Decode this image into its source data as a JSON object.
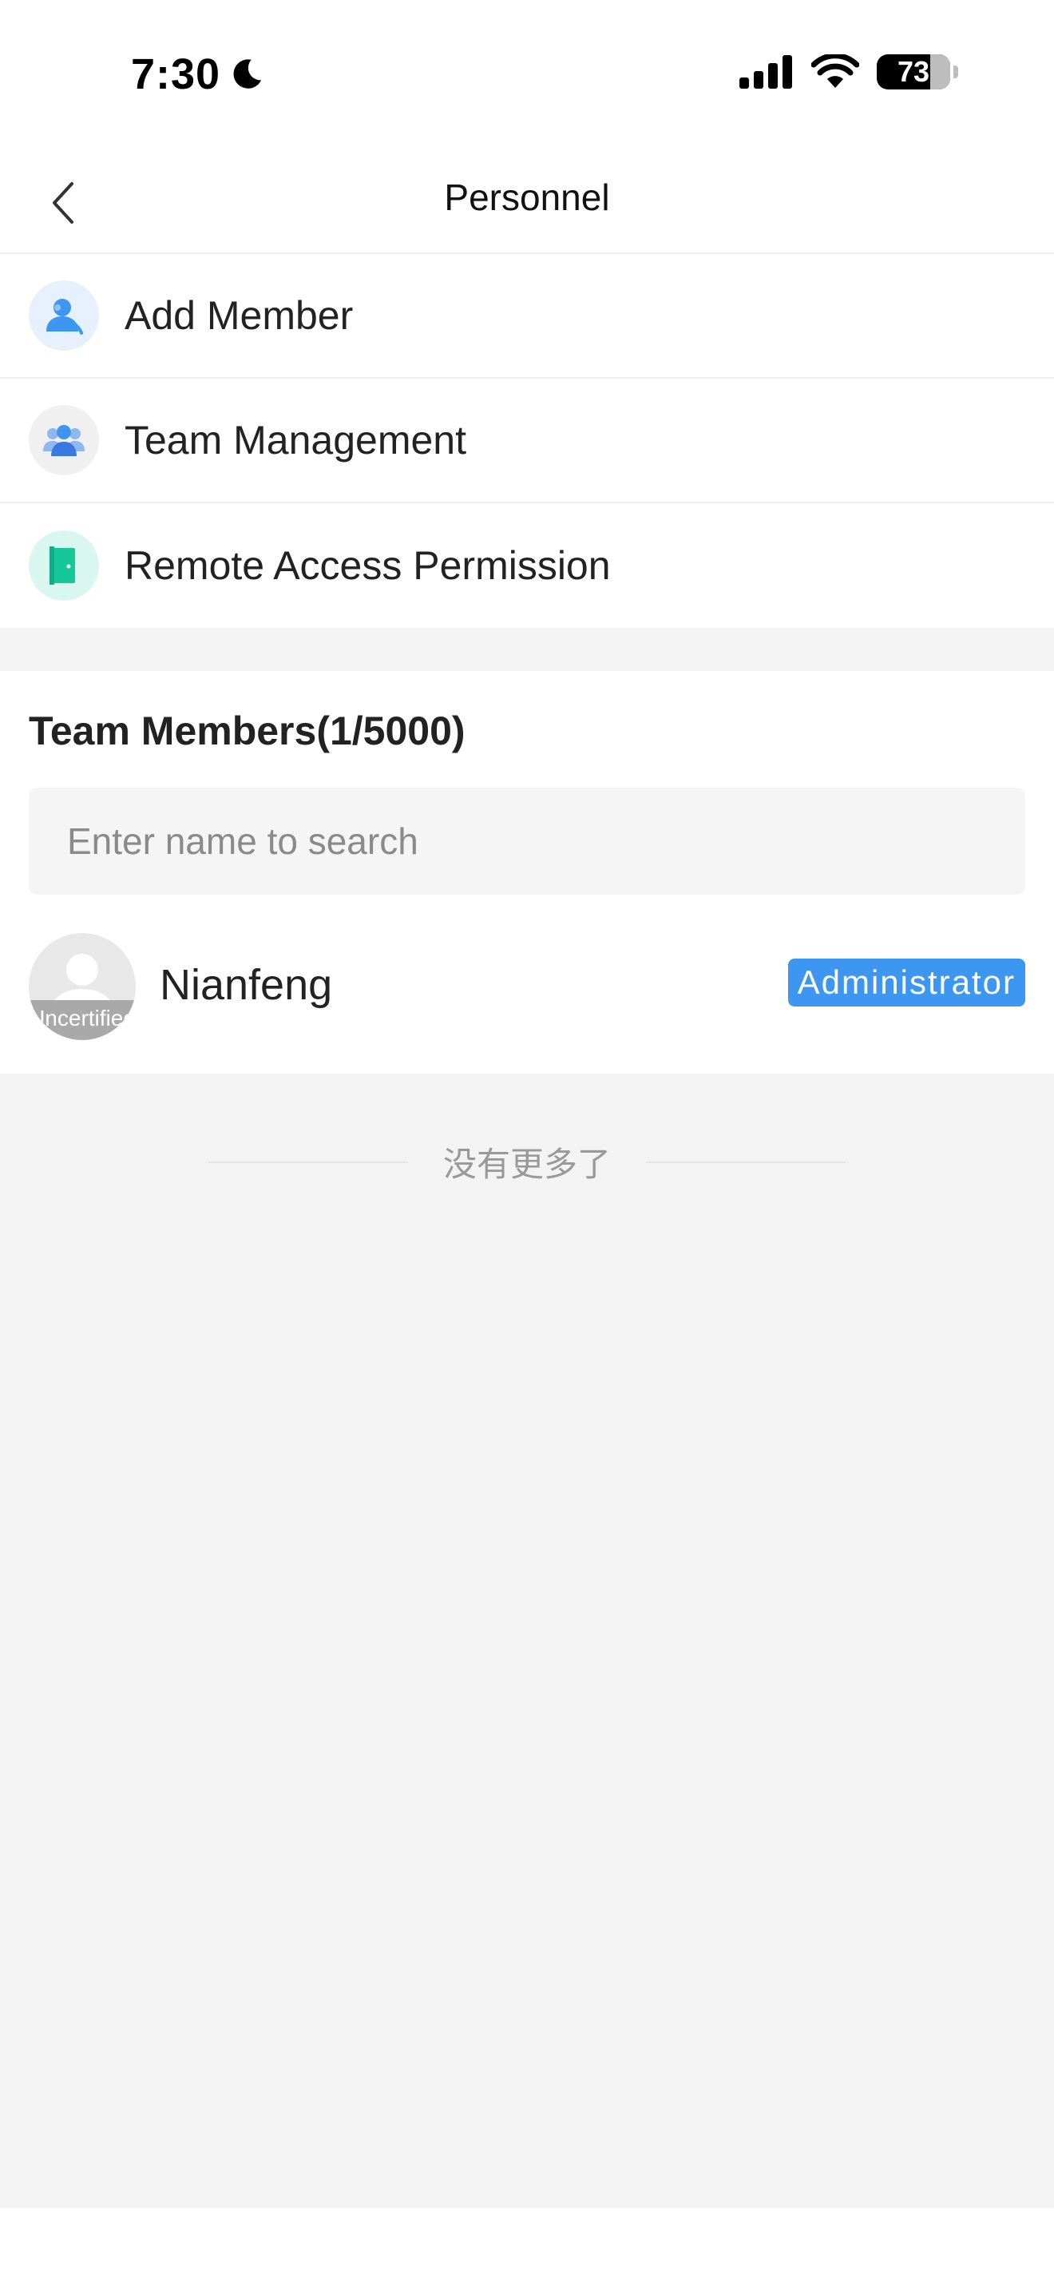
{
  "status_bar": {
    "time": "7:30",
    "battery_percent": "73",
    "battery_level": 0.73
  },
  "nav": {
    "title": "Personnel",
    "back_icon": "chevron-left-icon"
  },
  "menu": {
    "items": [
      {
        "label": "Add Member",
        "icon": "add-user-icon",
        "icon_bg": "#e6f1fd",
        "icon_color": "#3d96f0"
      },
      {
        "label": "Team Management",
        "icon": "team-icon",
        "icon_bg": "#f0f0f0",
        "icon_color": "#4a8ae8"
      },
      {
        "label": "Remote Access Permission",
        "icon": "door-icon",
        "icon_bg": "#d9f6ef",
        "icon_color": "#16c79a"
      }
    ]
  },
  "members": {
    "title": "Team Members(1/5000)",
    "search_placeholder": "Enter name to search",
    "list": [
      {
        "name": "Nianfeng",
        "avatar_tag": "Uncertified",
        "role": "Administrator"
      }
    ],
    "end_text": "没有更多了"
  },
  "colors": {
    "accent": "#3d96f0",
    "background": "#f3f3f3"
  }
}
